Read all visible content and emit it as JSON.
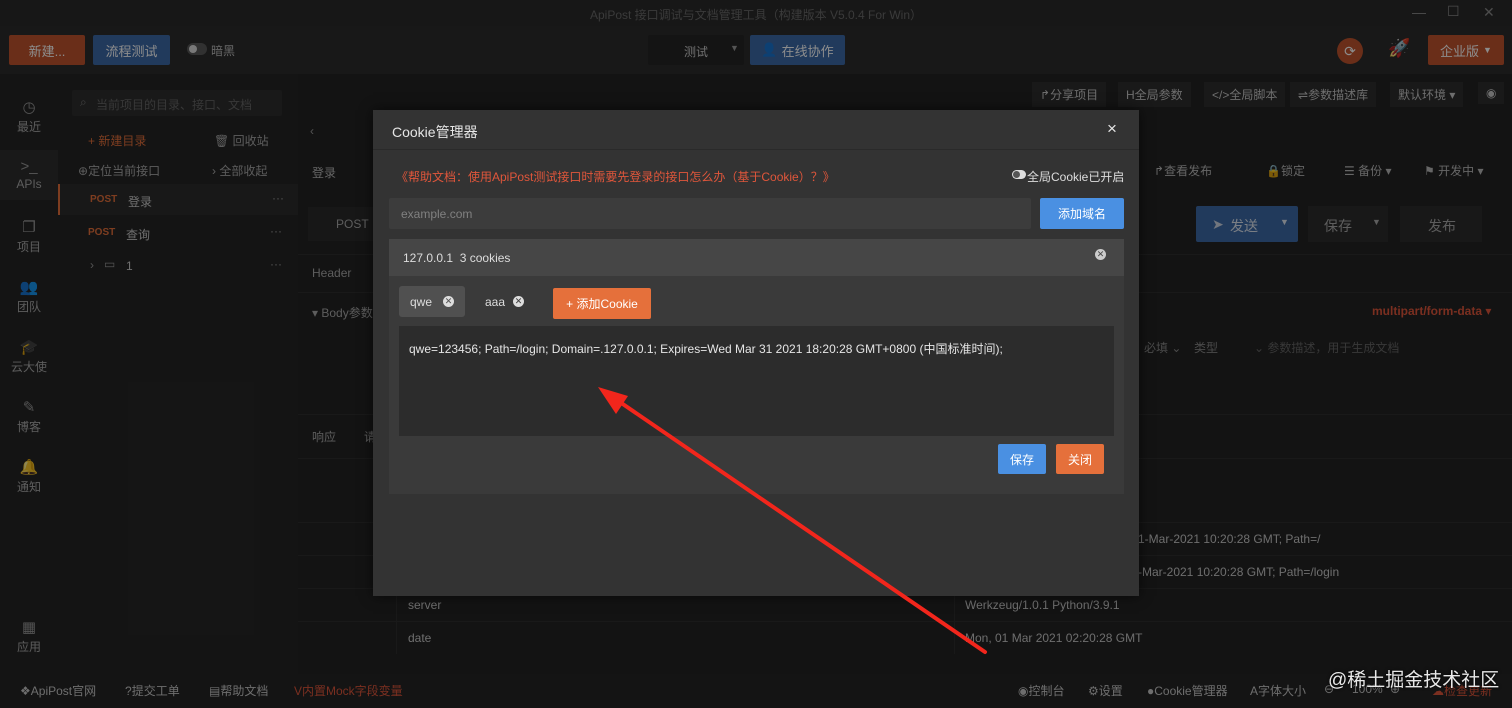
{
  "window": {
    "title": "ApiPost 接口调试与文档管理工具（构建版本 V5.0.4 For Win）"
  },
  "toolbar": {
    "new_label": "新建...",
    "flow_label": "流程测试",
    "dark_label": "暗黑",
    "env_label": "测试",
    "collab_label": "在线协作",
    "edition_label": "企业版"
  },
  "sidebar": {
    "items": [
      "最近",
      "APIs",
      "项目",
      "团队",
      "云大使",
      "博客",
      "通知",
      "应用"
    ]
  },
  "topbar": {
    "share": "分享项目",
    "global_params": "全局参数",
    "global_script": "全局脚本",
    "param_lib": "参数描述库",
    "default_env": "默认环境"
  },
  "tree": {
    "search_placeholder": "当前项目的目录、接口、文档",
    "new_dir": "新建目录",
    "recycle": "回收站",
    "locate": "定位当前接口",
    "collapse_all": "全部收起",
    "items": [
      {
        "method": "POST",
        "name": "登录"
      },
      {
        "method": "POST",
        "name": "查询"
      },
      {
        "name": "1"
      }
    ]
  },
  "main": {
    "tab_name": "登录",
    "view_publish": "查看发布",
    "lock": "锁定",
    "backup": "备份",
    "dev_mode": "开发中",
    "method": "POST",
    "send": "发送",
    "save": "保存",
    "publish": "发布",
    "header_tab": "Header",
    "body_label": "Body参数",
    "content_type": "multipart/form-data",
    "col_required": "必填",
    "col_type": "类型",
    "col_desc_placeholder": "参数描述，用于生成文档",
    "resp_tab": "响应",
    "req_tab": "请",
    "resp_rows": [
      {
        "name": "",
        "value": "1-Mar-2021 10:20:28 GMT; Path=/"
      },
      {
        "name": "",
        "value": "-Mar-2021 10:20:28 GMT; Path=/login"
      },
      {
        "name": "server",
        "value": "Werkzeug/1.0.1 Python/3.9.1"
      },
      {
        "name": "date",
        "value": "Mon, 01 Mar 2021 02:20:28 GMT"
      }
    ]
  },
  "footer": {
    "website": "ApiPost官网",
    "ticket": "提交工单",
    "help": "帮助文档",
    "mock": "内置Mock字段变量",
    "console": "控制台",
    "settings": "设置",
    "cookie_mgr": "Cookie管理器",
    "font_size": "字体大小",
    "zoom": "100%",
    "update": "检查更新",
    "watermark": "@稀土掘金技术社区"
  },
  "modal": {
    "title": "Cookie管理器",
    "close_symbol": "×",
    "help_link": "《帮助文档：使用ApiPost测试接口时需要先登录的接口怎么办（基于Cookie）？》",
    "global_toggle": "全局Cookie已开启",
    "domain_placeholder": "example.com",
    "add_domain": "添加域名",
    "domain_header": "127.0.0.1  3 cookies",
    "cookie_tabs": [
      "qwe",
      "aaa"
    ],
    "add_cookie": "+ 添加Cookie",
    "cookie_value": "qwe=123456; Path=/login; Domain=.127.0.0.1; Expires=Wed Mar 31 2021 18:20:28 GMT+0800 (中国标准时间);",
    "save": "保存",
    "close": "关闭"
  },
  "colors": {
    "accent_blue": "#4a90e2",
    "accent_orange": "#e5703b",
    "link_red": "#e0563b"
  }
}
